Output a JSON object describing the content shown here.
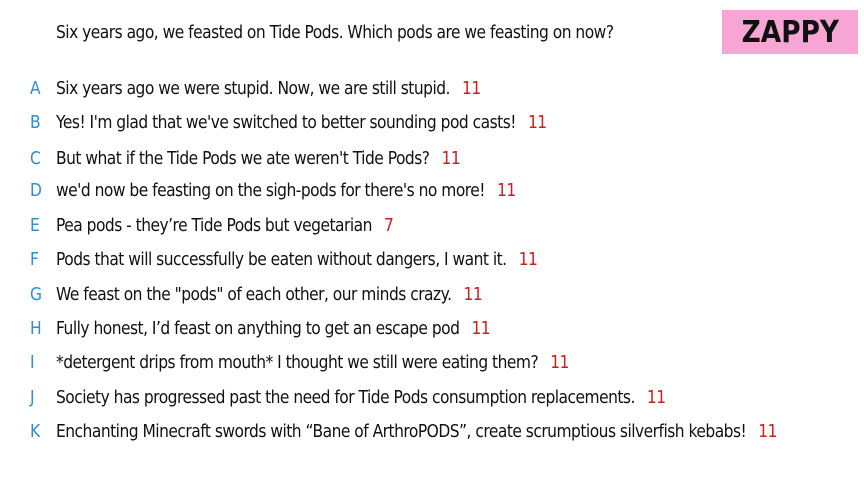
{
  "question": "Six years ago, we feasted on Tide Pods. Which pods are we feasting on now?",
  "brand": "ZAPPY",
  "answers": [
    {
      "letter": "A",
      "text": "Six years ago we were stupid. Now, we are still stupid.",
      "votes": "11"
    },
    {
      "letter": "B",
      "text": "Yes! I'm glad that we've switched to better sounding pod casts!",
      "votes": "11"
    },
    {
      "letter": "C",
      "text": "But what if the Tide Pods we ate weren't Tide Pods?",
      "votes": "11"
    },
    {
      "letter": "D",
      "text": "we'd now be feasting on the sigh-pods for there's no more!",
      "votes": "11"
    },
    {
      "letter": "E",
      "text": "Pea pods - they’re Tide Pods but vegetarian",
      "votes": "7"
    },
    {
      "letter": "F",
      "text": "Pods that will successfully be eaten without dangers, I want it.",
      "votes": "11"
    },
    {
      "letter": "G",
      "text": "We feast on the \"pods\" of each other, our minds crazy.",
      "votes": "11"
    },
    {
      "letter": "H",
      "text": "Fully honest, I’d feast on anything to get an escape pod",
      "votes": "11"
    },
    {
      "letter": "I",
      "text": "*detergent drips from mouth* I thought we still were eating them?",
      "votes": "11"
    },
    {
      "letter": "J",
      "text": "Society has progressed past the need for Tide Pods consumption replacements.",
      "votes": "11"
    },
    {
      "letter": "K",
      "text": "Enchanting Minecraft swords with “Bane of ArthroPODS”, create scrumptious silverfish kebabs!",
      "votes": "11"
    }
  ]
}
